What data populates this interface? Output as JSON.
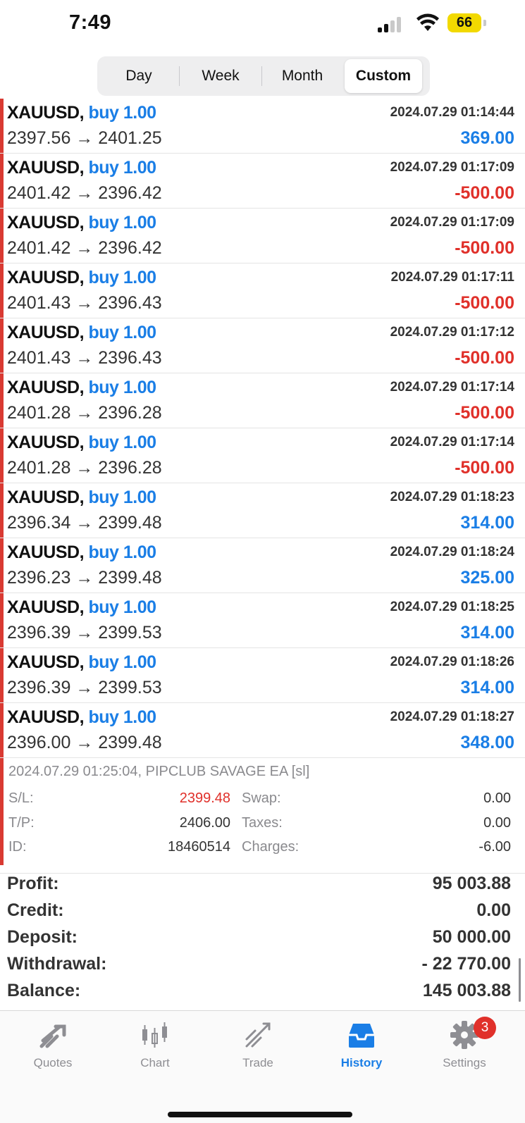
{
  "status_bar": {
    "time": "7:49",
    "battery": "66"
  },
  "segments": [
    {
      "label": "Day",
      "active": false
    },
    {
      "label": "Week",
      "active": false
    },
    {
      "label": "Month",
      "active": false
    },
    {
      "label": "Custom",
      "active": true
    }
  ],
  "deals": [
    {
      "symbol": "XAUUSD,",
      "side": "buy 1.00",
      "prices": "2397.56 → 2401.25",
      "time": "2024.07.29 01:14:44",
      "profit": "369.00",
      "sign": "pos"
    },
    {
      "symbol": "XAUUSD,",
      "side": "buy 1.00",
      "prices": "2401.42 → 2396.42",
      "time": "2024.07.29 01:17:09",
      "profit": "-500.00",
      "sign": "neg"
    },
    {
      "symbol": "XAUUSD,",
      "side": "buy 1.00",
      "prices": "2401.42 → 2396.42",
      "time": "2024.07.29 01:17:09",
      "profit": "-500.00",
      "sign": "neg"
    },
    {
      "symbol": "XAUUSD,",
      "side": "buy 1.00",
      "prices": "2401.43 → 2396.43",
      "time": "2024.07.29 01:17:11",
      "profit": "-500.00",
      "sign": "neg"
    },
    {
      "symbol": "XAUUSD,",
      "side": "buy 1.00",
      "prices": "2401.43 → 2396.43",
      "time": "2024.07.29 01:17:12",
      "profit": "-500.00",
      "sign": "neg"
    },
    {
      "symbol": "XAUUSD,",
      "side": "buy 1.00",
      "prices": "2401.28 → 2396.28",
      "time": "2024.07.29 01:17:14",
      "profit": "-500.00",
      "sign": "neg"
    },
    {
      "symbol": "XAUUSD,",
      "side": "buy 1.00",
      "prices": "2401.28 → 2396.28",
      "time": "2024.07.29 01:17:14",
      "profit": "-500.00",
      "sign": "neg"
    },
    {
      "symbol": "XAUUSD,",
      "side": "buy 1.00",
      "prices": "2396.34 → 2399.48",
      "time": "2024.07.29 01:18:23",
      "profit": "314.00",
      "sign": "pos"
    },
    {
      "symbol": "XAUUSD,",
      "side": "buy 1.00",
      "prices": "2396.23 → 2399.48",
      "time": "2024.07.29 01:18:24",
      "profit": "325.00",
      "sign": "pos"
    },
    {
      "symbol": "XAUUSD,",
      "side": "buy 1.00",
      "prices": "2396.39 → 2399.53",
      "time": "2024.07.29 01:18:25",
      "profit": "314.00",
      "sign": "pos"
    },
    {
      "symbol": "XAUUSD,",
      "side": "buy 1.00",
      "prices": "2396.39 → 2399.53",
      "time": "2024.07.29 01:18:26",
      "profit": "314.00",
      "sign": "pos"
    },
    {
      "symbol": "XAUUSD,",
      "side": "buy 1.00",
      "prices": "2396.00 → 2399.48",
      "time": "2024.07.29 01:18:27",
      "profit": "348.00",
      "sign": "pos"
    }
  ],
  "detail": {
    "header": "2024.07.29 01:25:04, PIPCLUB SAVAGE EA [sl]",
    "sl_label": "S/L:",
    "sl_value": "2399.48",
    "tp_label": "T/P:",
    "tp_value": "2406.00",
    "id_label": "ID:",
    "id_value": "18460514",
    "swap_label": "Swap:",
    "swap_value": "0.00",
    "taxes_label": "Taxes:",
    "taxes_value": "0.00",
    "charges_label": "Charges:",
    "charges_value": "-6.00"
  },
  "summary": [
    {
      "label": "Profit:",
      "value": "95 003.88"
    },
    {
      "label": "Credit:",
      "value": "0.00"
    },
    {
      "label": "Deposit:",
      "value": "50 000.00"
    },
    {
      "label": "Withdrawal:",
      "value": "- 22 770.00"
    },
    {
      "label": "Balance:",
      "value": "145 003.88"
    }
  ],
  "tabs": [
    {
      "label": "Quotes",
      "icon": "quotes-icon",
      "active": false
    },
    {
      "label": "Chart",
      "icon": "chart-icon",
      "active": false
    },
    {
      "label": "Trade",
      "icon": "trade-icon",
      "active": false
    },
    {
      "label": "History",
      "icon": "history-icon",
      "active": true
    },
    {
      "label": "Settings",
      "icon": "gear-icon",
      "active": false
    }
  ],
  "settings_badge": "3",
  "colors": {
    "buy": "#1a7ee6",
    "profit_positive": "#1a7ee6",
    "profit_negative": "#e0302a",
    "accent": "#1a7ee6",
    "closed_marker": "#d93a32"
  }
}
